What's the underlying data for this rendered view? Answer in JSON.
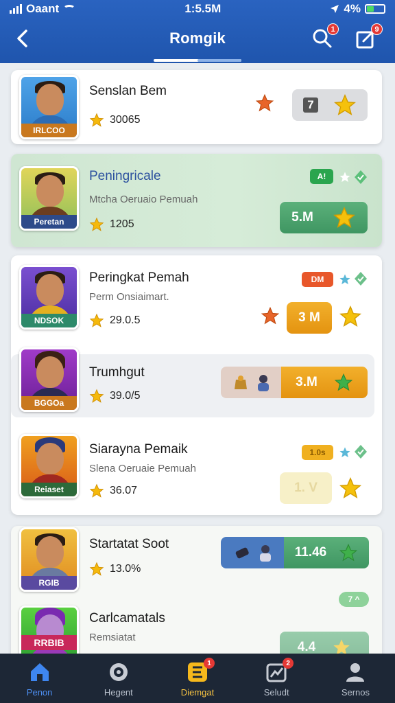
{
  "status": {
    "carrier": "Oaant",
    "time": "1:5.5M",
    "battery": "4%"
  },
  "header": {
    "title": "Romgik",
    "search_badge": "1",
    "edit_badge": "9"
  },
  "cards": [
    {
      "name": "Senslan Bem",
      "rating": "30065",
      "tag": "IRLCOO",
      "pill": "7"
    },
    {
      "name": "Peningricale",
      "subtitle": "Mtcha Oeruaio Pemuah",
      "rating": "1205",
      "tag": "Peretan",
      "mini_tag": "A!",
      "pill": "5.M"
    },
    {
      "name": "Peringkat Pemah",
      "subtitle": "Perm Onsiaimart.",
      "rating": "29.0.5",
      "tag": "NDSOK",
      "mini_tag": "DM",
      "pill": "3 M"
    },
    {
      "name": "Trumhgut",
      "rating": "39.0/5",
      "tag": "BGGOa",
      "pill": "3.M"
    },
    {
      "name": "Siarayna Pemaik",
      "subtitle": "Slena Oeruaie Pemuah",
      "rating": "36.07",
      "tag": "Reiaset",
      "mini_tag": "1.0s",
      "pill": "1. V"
    },
    {
      "name": "Startatat Soot",
      "rating": "13.0%",
      "tag": "RGIB",
      "pill": "11.46",
      "mini_tag": "7 ^"
    },
    {
      "name": "Carlcamatals",
      "subtitle": "Remsiatat",
      "tag": "RRBIB",
      "pill": "4.4"
    }
  ],
  "nav": [
    {
      "label": "Penon",
      "icon": "home-icon"
    },
    {
      "label": "Hegent",
      "icon": "target-icon"
    },
    {
      "label": "Diemgat",
      "icon": "ranking-icon",
      "badge": "1"
    },
    {
      "label": "Seludt",
      "icon": "chart-icon",
      "badge": "2"
    },
    {
      "label": "Sernos",
      "icon": "profile-icon"
    }
  ]
}
